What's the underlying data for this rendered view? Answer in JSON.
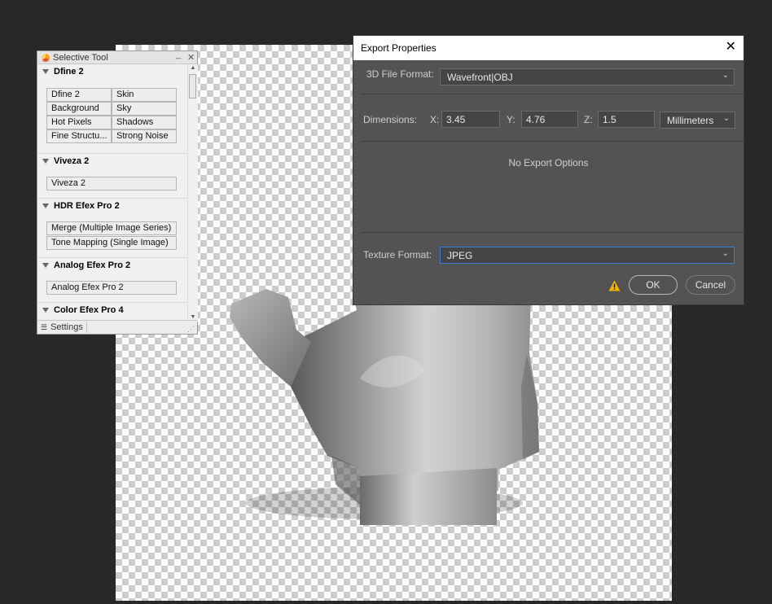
{
  "selective_tool": {
    "title": "Selective Tool",
    "minimize_glyph": "_",
    "close_glyph": "✕",
    "sections": [
      {
        "name": "Dfine 2",
        "buttons": [
          "Dfine 2",
          "Skin",
          "Background",
          "Sky",
          "Hot Pixels",
          "Shadows",
          "Fine Structu...",
          "Strong Noise"
        ]
      },
      {
        "name": "Viveza 2",
        "buttons": [
          "Viveza 2"
        ]
      },
      {
        "name": "HDR Efex Pro 2",
        "buttons": [
          "Merge (Multiple Image Series)",
          "Tone Mapping (Single Image)"
        ]
      },
      {
        "name": "Analog Efex Pro 2",
        "buttons": [
          "Analog Efex Pro 2"
        ]
      },
      {
        "name": "Color Efex Pro 4",
        "buttons": []
      }
    ],
    "settings_label": "Settings",
    "icons": [
      "nik-logo-icon",
      "minimize-icon",
      "close-icon",
      "collapse-triangle-icon",
      "scroll-up-icon",
      "scroll-down-icon",
      "settings-icon",
      "resize-grip-icon"
    ]
  },
  "dialog": {
    "title": "Export Properties",
    "close_glyph": "✕",
    "file_format_label": "3D File Format:",
    "file_format_value": "Wavefront|OBJ",
    "dimensions_label": "Dimensions:",
    "x_label": "X:",
    "x_value": "3.45",
    "y_label": "Y:",
    "y_value": "4.76",
    "z_label": "Z:",
    "z_value": "1.5",
    "units_value": "Millimeters",
    "no_options_text": "No Export Options",
    "texture_label": "Texture Format:",
    "texture_value": "JPEG",
    "ok_label": "OK",
    "cancel_label": "Cancel",
    "icons": [
      "warning-icon",
      "chevron-down-icon"
    ]
  },
  "colors": {
    "app_background": "#282828",
    "dialog_background": "#535353",
    "focus_accent": "#3d7bd4",
    "warning": "#f5b400"
  }
}
